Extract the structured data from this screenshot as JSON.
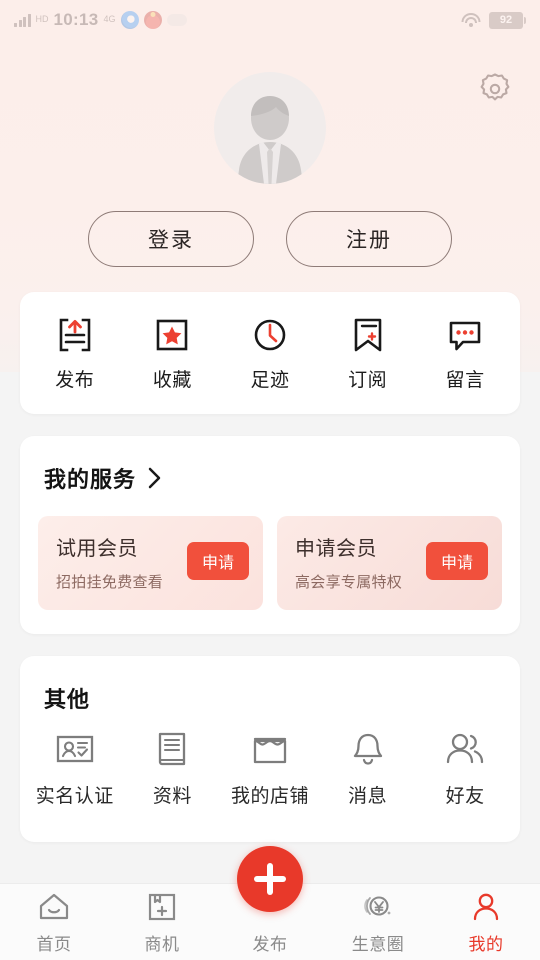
{
  "statusbar": {
    "time": "10:13",
    "carrier_top": "HD",
    "carrier_sub": "4G",
    "signal_icon": "signal-bars-icon",
    "app_icons": [
      "browser-icon",
      "red-app-icon",
      "cloud-icon"
    ],
    "wifi_icon": "wifi-icon",
    "battery_level": "92"
  },
  "header": {
    "settings_icon": "gear-icon",
    "avatar_icon": "default-user-avatar",
    "login_label": "登录",
    "register_label": "注册"
  },
  "quick_actions": [
    {
      "label": "发布",
      "icon": "upload-publish-icon"
    },
    {
      "label": "收藏",
      "icon": "star-favorite-icon"
    },
    {
      "label": "足迹",
      "icon": "clock-history-icon"
    },
    {
      "label": "订阅",
      "icon": "bookmark-subscribe-icon"
    },
    {
      "label": "留言",
      "icon": "chat-bubble-message-icon"
    }
  ],
  "services": {
    "title": "我的服务",
    "chevron_icon": "chevron-right-icon",
    "promos": [
      {
        "title": "试用会员",
        "subtitle": "招拍挂免费查看",
        "button_label": "申请"
      },
      {
        "title": "申请会员",
        "subtitle": "高会享专属特权",
        "button_label": "申请"
      }
    ]
  },
  "other": {
    "title": "其他",
    "items": [
      {
        "label": "实名认证",
        "icon": "id-card-verify-icon"
      },
      {
        "label": "资料",
        "icon": "document-profile-icon"
      },
      {
        "label": "我的店铺",
        "icon": "shop-storefront-icon"
      },
      {
        "label": "消息",
        "icon": "bell-notification-icon"
      },
      {
        "label": "好友",
        "icon": "users-friends-icon"
      }
    ]
  },
  "tabbar": {
    "items": [
      {
        "label": "首页",
        "icon": "home-icon",
        "active": false
      },
      {
        "label": "商机",
        "icon": "briefcase-add-icon",
        "active": false
      },
      {
        "label": "发布",
        "icon": "plus-fab-icon",
        "active": false
      },
      {
        "label": "生意圈",
        "icon": "yuan-coin-icon",
        "active": false
      },
      {
        "label": "我的",
        "icon": "person-profile-icon",
        "active": true
      }
    ]
  },
  "colors": {
    "accent_red": "#e8392a",
    "apply_red": "#f1503c",
    "header_pink": "#fceeea",
    "page_gray": "#f4f4f4",
    "card_white": "#ffffff"
  }
}
